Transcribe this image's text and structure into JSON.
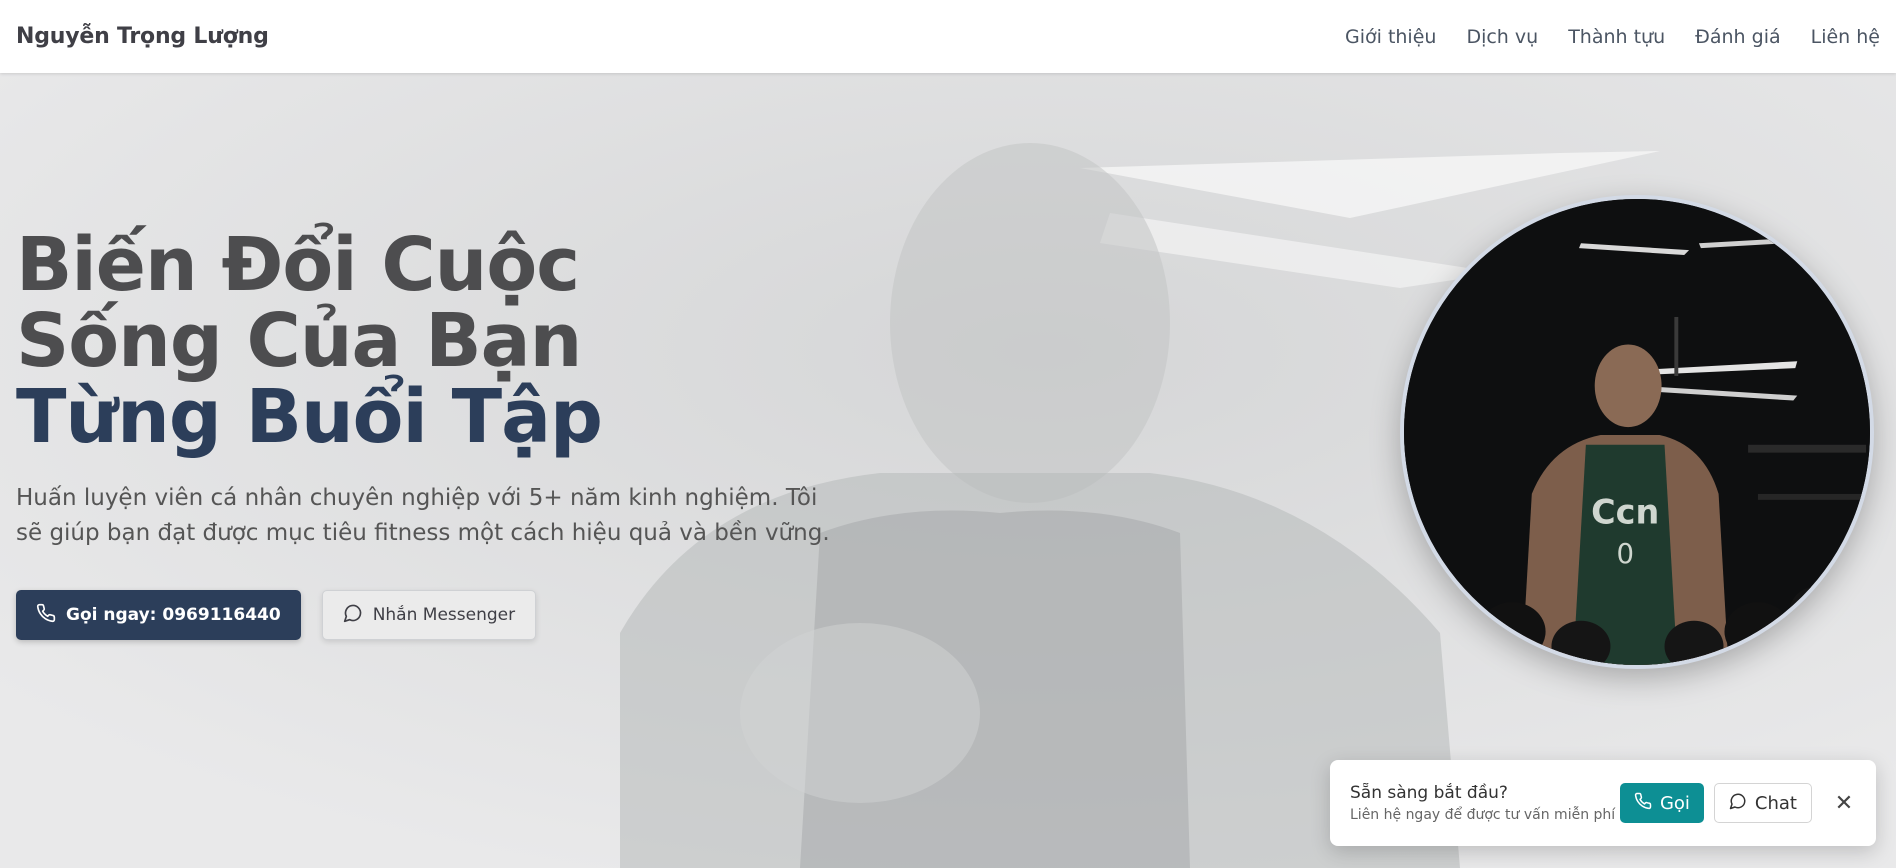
{
  "nav": {
    "brand": "Nguyễn Trọng Lượng",
    "items": [
      {
        "label": "Giới thiệu"
      },
      {
        "label": "Dịch vụ"
      },
      {
        "label": "Thành tựu"
      },
      {
        "label": "Đánh giá"
      },
      {
        "label": "Liên hệ"
      }
    ]
  },
  "hero": {
    "headline_line1": "Biến Đổi Cuộc",
    "headline_line2": "Sống Của Bạn",
    "headline_line3": "Từng Buổi Tập",
    "subtitle": "Huấn luyện viên cá nhân chuyên nghiệp với 5+ năm kinh nghiệm. Tôi sẽ giúp bạn đạt được mục tiêu fitness một cách hiệu quả và bền vững.",
    "call_button": "Gọi ngay: 0969116440",
    "messenger_button": "Nhắn Messenger"
  },
  "cta": {
    "title": "Sẵn sàng bắt đầu?",
    "subtitle": "Liên hệ ngay để được tư vấn miễn phí",
    "call_label": "Gọi",
    "chat_label": "Chat",
    "close_symbol": "✕"
  },
  "colors": {
    "accent": "#2c3e5a",
    "teal": "#0d8f94",
    "background": "#e7e8e9"
  },
  "icons": [
    "phone-icon",
    "chat-bubble-icon",
    "close-icon"
  ]
}
